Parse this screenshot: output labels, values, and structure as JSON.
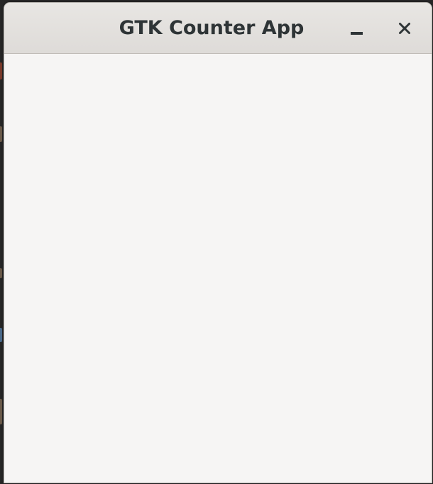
{
  "window": {
    "title": "GTK Counter App",
    "buttons": {
      "minimize_icon": "minimize-icon",
      "close_icon": "close-icon"
    }
  },
  "colors": {
    "headerbar": "#dedbd8",
    "window_background": "#f6f5f4",
    "title_text": "#2e3436"
  }
}
